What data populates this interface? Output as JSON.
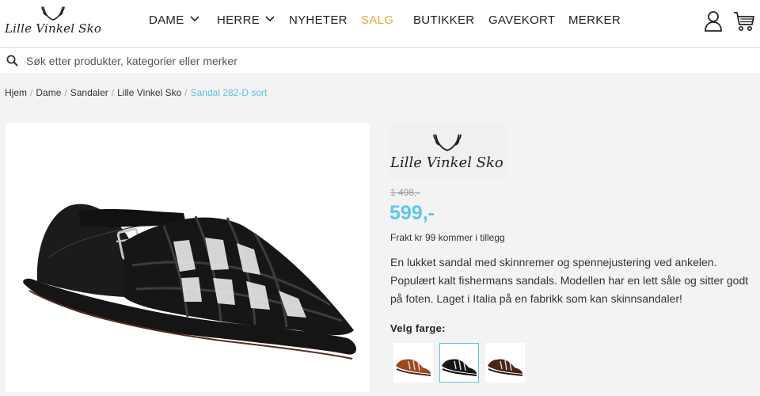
{
  "brand": {
    "name": "Lille Vinkel Sko"
  },
  "nav": {
    "items": [
      {
        "label": "DAME",
        "dropdown": true
      },
      {
        "label": "HERRE",
        "dropdown": true
      },
      {
        "label": "NYHETER",
        "dropdown": false
      },
      {
        "label": "SALG",
        "dropdown": false,
        "highlight": true
      },
      {
        "label": "BUTIKKER",
        "dropdown": false
      },
      {
        "label": "GAVEKORT",
        "dropdown": false
      },
      {
        "label": "MERKER",
        "dropdown": false
      }
    ],
    "icons": [
      "user-icon",
      "cart-icon"
    ]
  },
  "search": {
    "placeholder": "Søk etter produkter, kategorier eller merker",
    "value": ""
  },
  "breadcrumb": [
    "Hjem",
    "Dame",
    "Sandaler",
    "Lille Vinkel Sko"
  ],
  "breadcrumb_current": "Sandal 282-D sort",
  "product": {
    "brand_logo_text": "Lille Vinkel Sko",
    "old_price": "1 498,-",
    "price": "599,-",
    "shipping": "Frakt kr 99 kommer i tillegg",
    "description": "En lukket sandal med skinnremer og spennejustering ved ankelen. Populært kalt fishermans sandals. Modellen har en lett såle og sitter godt på foten. Laget i Italia på en fabrikk som kan skinnsandaler!",
    "color_label": "Velg farge:",
    "colors": [
      {
        "name": "brown",
        "hex": "#9a4a1f",
        "selected": false
      },
      {
        "name": "black",
        "hex": "#151515",
        "selected": true
      },
      {
        "name": "dark-brown",
        "hex": "#4a2417",
        "selected": false
      }
    ]
  },
  "colors": {
    "accent": "#5bc0de",
    "sale": "#e8a33c",
    "price": "#5bc8ee"
  }
}
